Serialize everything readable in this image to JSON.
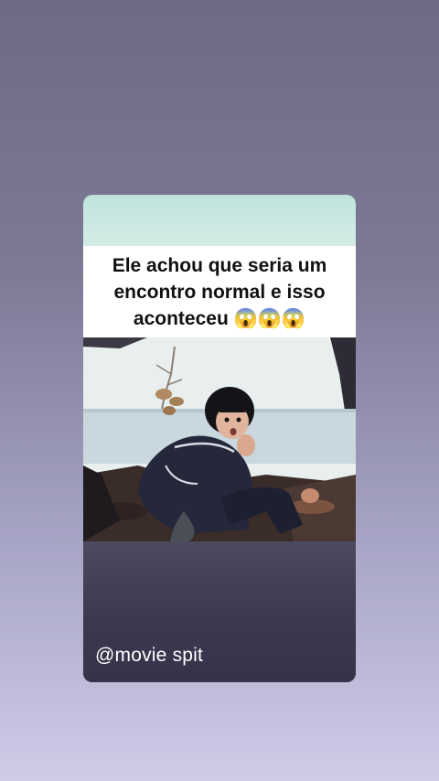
{
  "post": {
    "caption": "Ele achou que seria um encontro normal e isso aconteceu 😱😱😱",
    "watermark": "@movie spit"
  },
  "colors": {
    "background_top": "#6c6a84",
    "background_bottom": "#cfcce8",
    "caption_background": "#ffffff",
    "caption_text": "#111111",
    "watermark_text": "#ffffff"
  }
}
